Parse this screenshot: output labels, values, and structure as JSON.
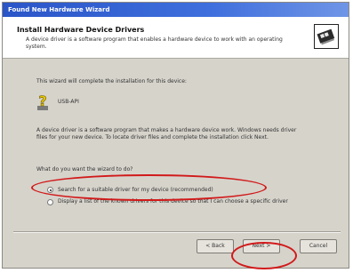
{
  "window": {
    "title": "Found New Hardware Wizard"
  },
  "header": {
    "title": "Install Hardware Device Drivers",
    "subtitle": "A device driver is a software program that enables a hardware device to work with an operating system.",
    "icon": "hardware-card-icon"
  },
  "content": {
    "intro": "This wizard will complete the installation for this device:",
    "device_name": "USB-API",
    "device_icon": "question-mark-icon",
    "description": "A device driver is a software program that makes a hardware device work. Windows needs driver files for your new device. To locate driver files and complete the installation click Next.",
    "question": "What do you want the wizard to do?",
    "options": [
      {
        "label": "Search for a suitable driver for my device (recommended)",
        "selected": true
      },
      {
        "label": "Display a list of the known drivers for this device so that I can choose a specific driver",
        "selected": false
      }
    ]
  },
  "buttons": {
    "back": "< Back",
    "next": "Next >",
    "cancel": "Cancel"
  },
  "annotations": {
    "highlight_color": "#d11a1a"
  }
}
